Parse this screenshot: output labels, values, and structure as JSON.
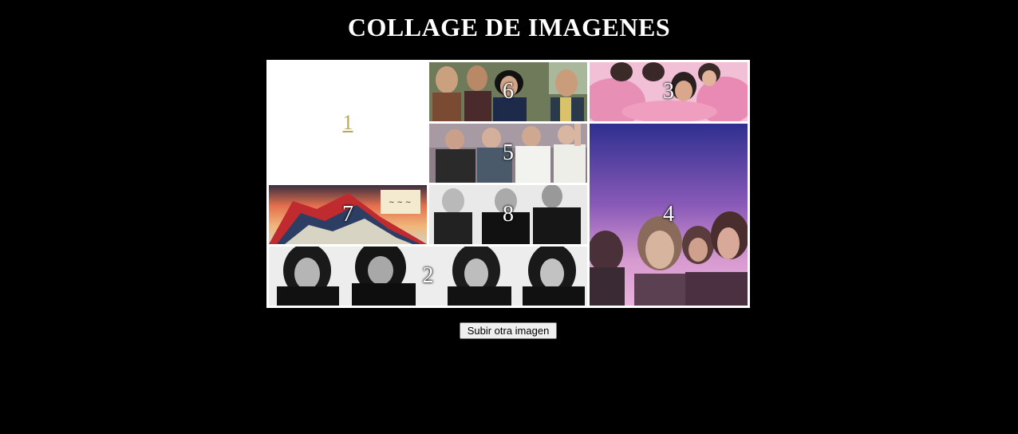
{
  "page": {
    "title": "COLLAGE DE IMAGENES"
  },
  "collage": {
    "tiles": {
      "t1": {
        "label": "1",
        "is_link": true
      },
      "t6": {
        "label": "6",
        "image": "band-photo-group-outdoor"
      },
      "t3": {
        "label": "3",
        "image": "band-photo-pink-scarves"
      },
      "t5": {
        "label": "5",
        "image": "band-photo-waving"
      },
      "t4": {
        "label": "4",
        "image": "band-photo-purple-sky"
      },
      "t7": {
        "label": "7",
        "image": "album-art-marching-hammers"
      },
      "t8": {
        "label": "8",
        "image": "band-photo-black-and-white"
      },
      "t2": {
        "label": "2",
        "image": "band-photo-black-and-white-wide"
      }
    }
  },
  "actions": {
    "upload_label": "Subir otra imagen"
  }
}
